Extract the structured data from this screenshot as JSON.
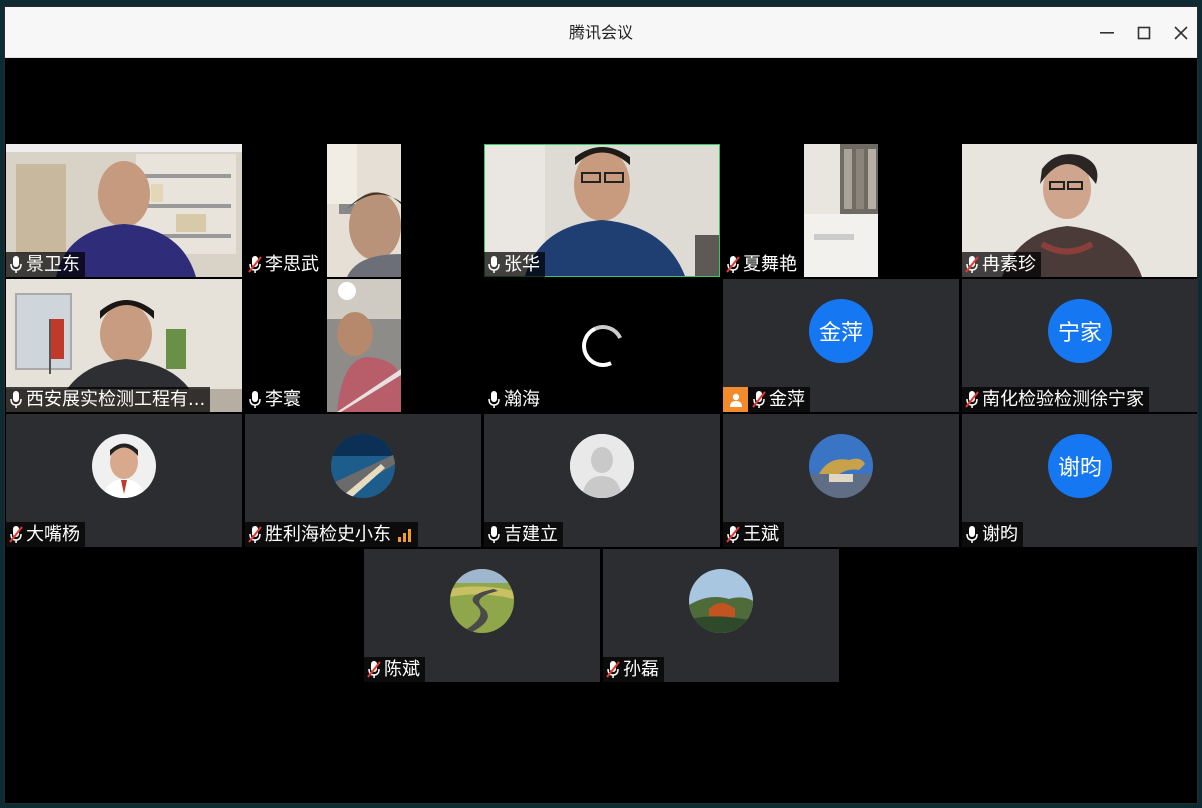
{
  "window": {
    "title": "腾讯会议",
    "controls": {
      "minimize_icon": "minimize-icon",
      "maximize_icon": "maximize-icon",
      "close_icon": "close-icon"
    }
  },
  "participants": [
    {
      "name": "景卫东",
      "mic": "on",
      "view": "video"
    },
    {
      "name": "李思武",
      "mic": "muted",
      "view": "video"
    },
    {
      "name": "张华",
      "mic": "on",
      "view": "video",
      "speaking": true
    },
    {
      "name": "夏舞艳",
      "mic": "muted",
      "view": "video"
    },
    {
      "name": "冉素珍",
      "mic": "muted",
      "view": "video"
    },
    {
      "name": "西安展实检测工程有...",
      "mic": "on",
      "view": "video"
    },
    {
      "name": "李寰",
      "mic": "on",
      "view": "video"
    },
    {
      "name": "瀚海",
      "mic": "on",
      "view": "loading"
    },
    {
      "name": "金萍",
      "mic": "muted",
      "view": "avatar",
      "avatar_text": "金萍",
      "host": true
    },
    {
      "name": "南化检验检测徐宁家",
      "mic": "muted",
      "view": "avatar",
      "avatar_text": "宁家"
    },
    {
      "name": "大嘴杨",
      "mic": "muted",
      "view": "avatar"
    },
    {
      "name": "胜利海检史小东",
      "mic": "muted",
      "view": "avatar",
      "signal": "weak"
    },
    {
      "name": "吉建立",
      "mic": "on",
      "view": "avatar"
    },
    {
      "name": "王斌",
      "mic": "muted",
      "view": "avatar"
    },
    {
      "name": "谢昀",
      "mic": "on",
      "view": "avatar",
      "avatar_text": "谢昀"
    },
    {
      "name": "陈斌",
      "mic": "muted",
      "view": "avatar"
    },
    {
      "name": "孙磊",
      "mic": "muted",
      "view": "avatar"
    }
  ],
  "colors": {
    "avatar_blue": "#1677f2",
    "speaking_border": "#39c66b",
    "tile_bg": "#2b2d31",
    "host_badge": "#f28b2c",
    "signal_weak": "#f39b2b"
  }
}
